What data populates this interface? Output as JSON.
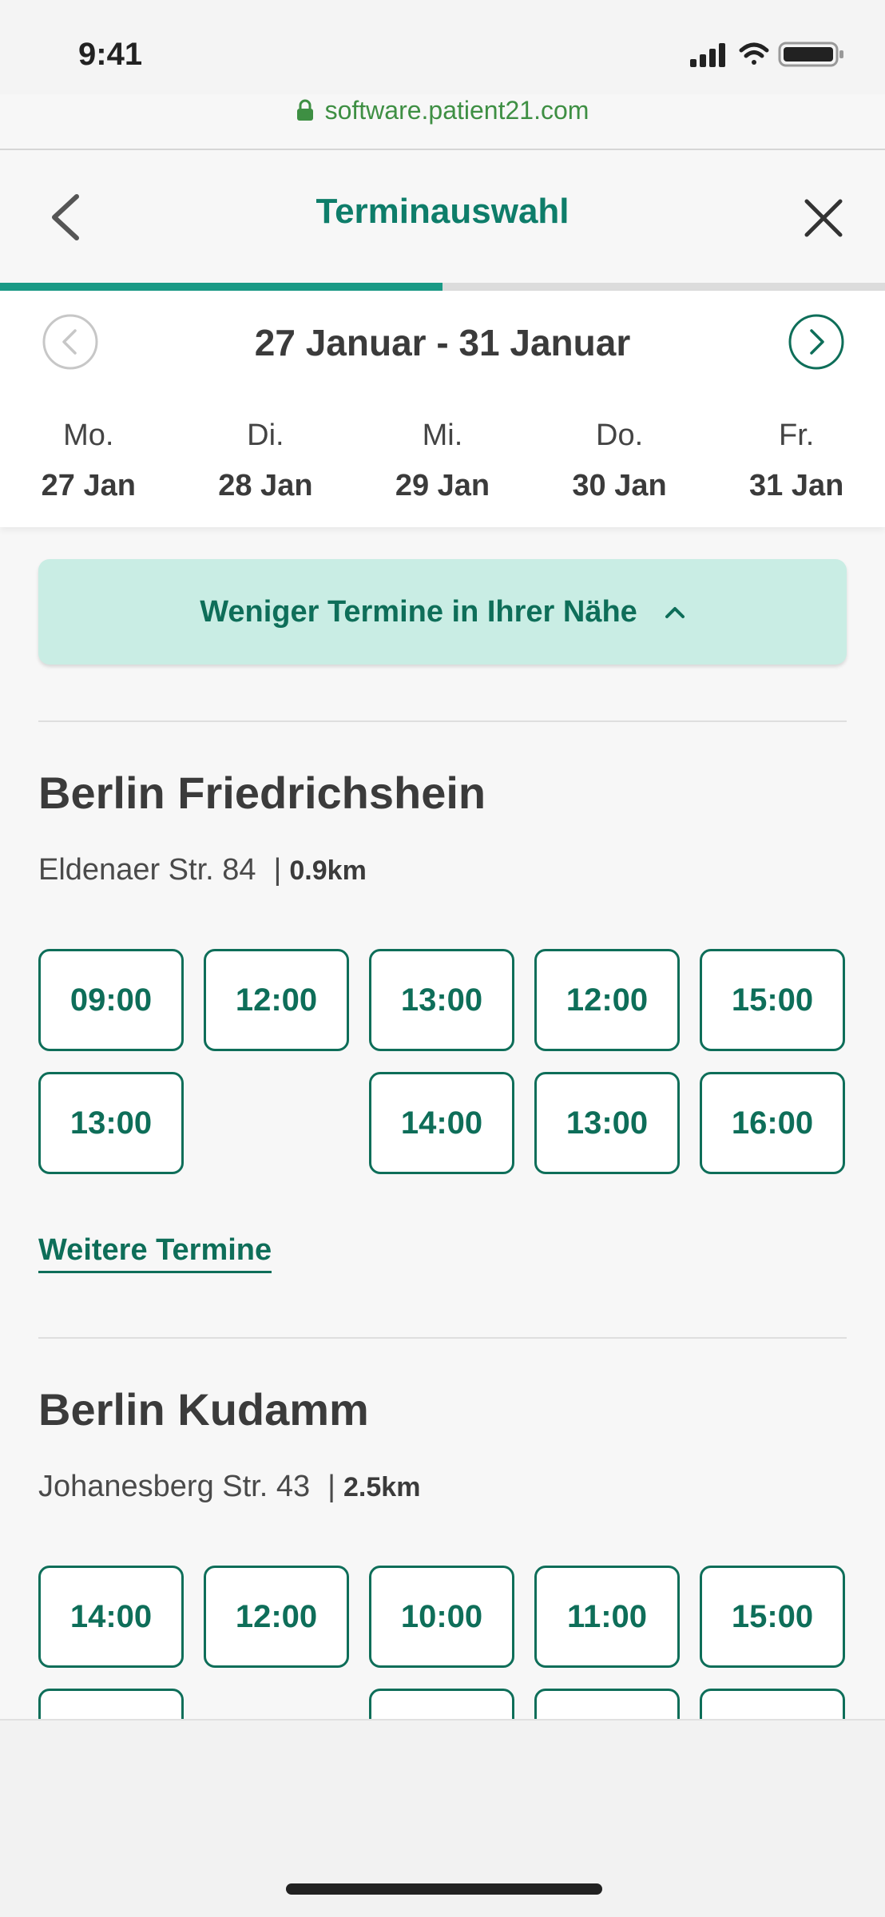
{
  "status_bar": {
    "time": "9:41",
    "url": "software.patient21.com"
  },
  "header": {
    "title": "Terminauswahl",
    "back_icon": "chevron-left-icon",
    "close_icon": "close-icon"
  },
  "progress": {
    "fraction": 0.5
  },
  "week": {
    "range": "27 Januar - 31 Januar",
    "days": [
      {
        "name": "Mo.",
        "date": "27 Jan"
      },
      {
        "name": "Di.",
        "date": "28 Jan"
      },
      {
        "name": "Mi.",
        "date": "29 Jan"
      },
      {
        "name": "Do.",
        "date": "30 Jan"
      },
      {
        "name": "Fr.",
        "date": "31 Jan"
      }
    ]
  },
  "nearby": {
    "label": "Weniger Termine in Ihrer Nähe"
  },
  "locations": [
    {
      "name": "Berlin Friedrichshein",
      "address": "Eldenaer Str. 84",
      "separator": "|",
      "distance": "0.9km",
      "slots_row1": [
        "09:00",
        "12:00",
        "13:00",
        "12:00",
        "15:00"
      ],
      "slots_row2": [
        "13:00",
        "",
        "14:00",
        "13:00",
        "16:00"
      ],
      "more_label": "Weitere Termine"
    },
    {
      "name": "Berlin Kudamm",
      "address": "Johanesberg Str. 43",
      "separator": "|",
      "distance": "2.5km",
      "slots_row1": [
        "14:00",
        "12:00",
        "10:00",
        "11:00",
        "15:00"
      ]
    }
  ],
  "colors": {
    "accent": "#0e7d6a",
    "slot_border": "#0e6e59",
    "banner_bg": "#c9ede4",
    "url": "#3e8f43"
  }
}
